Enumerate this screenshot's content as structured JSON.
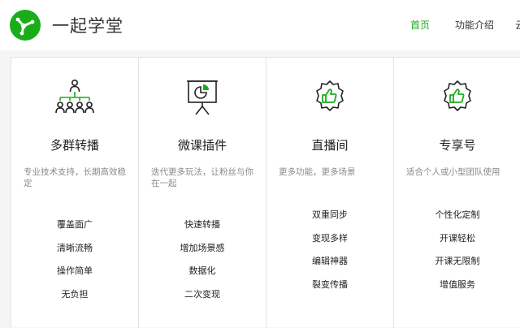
{
  "brand": {
    "name": "一起学堂",
    "color": "#1aad19"
  },
  "nav": [
    {
      "label": "首页",
      "active": true
    },
    {
      "label": "功能介绍",
      "active": false
    },
    {
      "label": "云"
    }
  ],
  "cards": [
    {
      "icon": "network-people-icon",
      "title": "多群转播",
      "desc": "专业技术支持，长期高效稳定",
      "features": [
        "覆盖面广",
        "清晰流畅",
        "操作简单",
        "无负担"
      ]
    },
    {
      "icon": "presentation-board-icon",
      "title": "微课插件",
      "desc": "迭代更多玩法，让粉丝与你在一起",
      "features": [
        "快速转播",
        "增加场景感",
        "数据化",
        "二次变现"
      ]
    },
    {
      "icon": "thumbs-up-badge-icon",
      "title": "直播间",
      "desc": "更多功能，更多场景",
      "features": [
        "双重同步",
        "变现多样",
        "编辑神器",
        "裂变传播"
      ]
    },
    {
      "icon": "thumbs-up-badge-icon",
      "title": "专享号",
      "desc": "适合个人或小型团队使用",
      "features": [
        "个性化定制",
        "开课轻松",
        "开课无限制",
        "增值服务"
      ]
    }
  ]
}
